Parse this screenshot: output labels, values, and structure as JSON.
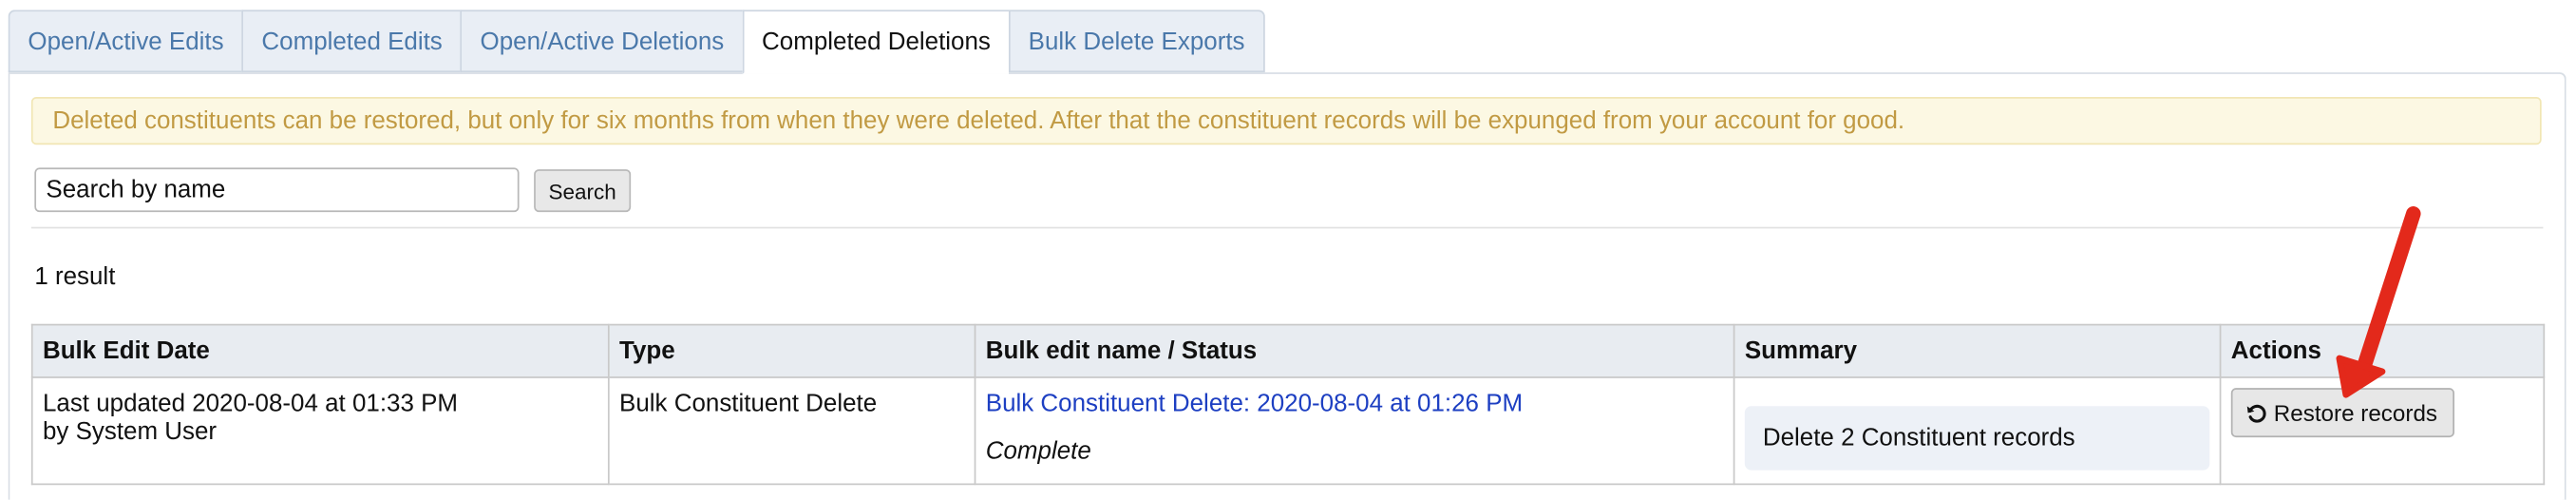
{
  "tabs": [
    {
      "label": "Open/Active Edits",
      "active": false
    },
    {
      "label": "Completed Edits",
      "active": false
    },
    {
      "label": "Open/Active Deletions",
      "active": false
    },
    {
      "label": "Completed Deletions",
      "active": true
    },
    {
      "label": "Bulk Delete Exports",
      "active": false
    }
  ],
  "alert": {
    "text": "Deleted constituents can be restored, but only for six months from when they were deleted. After that the constituent records will be expunged from your account for good."
  },
  "search": {
    "placeholder": "Search by name",
    "value": "",
    "button_label": "Search"
  },
  "results": {
    "count_label": "1 result"
  },
  "table": {
    "headers": [
      "Bulk Edit Date",
      "Type",
      "Bulk edit name / Status",
      "Summary",
      "Actions"
    ],
    "rows": [
      {
        "date_line1": "Last updated 2020-08-04 at 01:33 PM",
        "date_line2": "by System User",
        "type": "Bulk Constituent Delete",
        "name": "Bulk Constituent Delete: 2020-08-04 at 01:26 PM",
        "status": "Complete",
        "summary": "Delete 2 Constituent records",
        "action_label": "Restore records",
        "action_icon": "undo-icon"
      }
    ]
  },
  "annotation": {
    "icon": "red-arrow-icon",
    "color": "#e3291b"
  },
  "colors": {
    "link": "#1d3fc2",
    "tab_text": "#4a78aa",
    "alert_text": "#c19a43",
    "alert_bg": "#fcf8e3"
  }
}
